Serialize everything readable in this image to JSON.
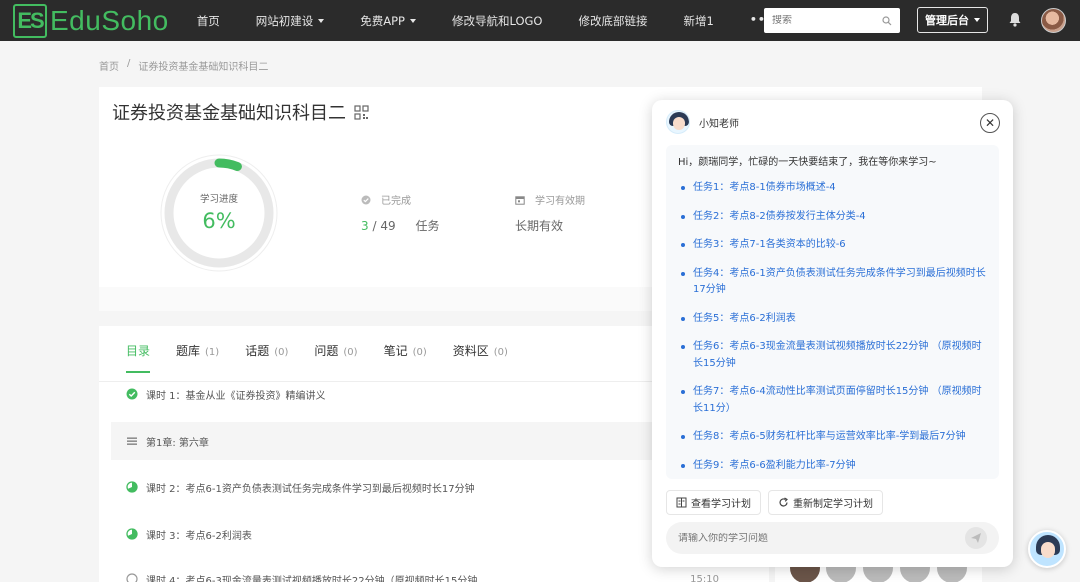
{
  "header": {
    "logo_mark": "ES",
    "logo_text": "EduSoho",
    "nav": [
      {
        "label": "首页",
        "has_caret": false
      },
      {
        "label": "网站初建设",
        "has_caret": true
      },
      {
        "label": "免费APP",
        "has_caret": true
      },
      {
        "label": "修改导航和LOGO",
        "has_caret": false
      },
      {
        "label": "修改底部链接",
        "has_caret": false
      },
      {
        "label": "新增1",
        "has_caret": false
      }
    ],
    "more_label": "•••",
    "search_placeholder": "搜索",
    "admin_label": "管理后台"
  },
  "breadcrumb": {
    "home": "首页",
    "separator": "/",
    "current": "证券投资基金基础知识科目二"
  },
  "course": {
    "title": "证券投资基金基础知识科目二",
    "progress_label": "学习进度",
    "progress_value": "6%",
    "progress_fraction": 0.06,
    "completed_label": "已完成",
    "completed_done": "3",
    "completed_total": "/ 49",
    "completed_unit": "任务",
    "validity_label": "学习有效期",
    "validity_value": "长期有效"
  },
  "tabs": [
    {
      "label": "目录",
      "count": "",
      "active": true
    },
    {
      "label": "题库",
      "count": "(1)",
      "active": false
    },
    {
      "label": "话题",
      "count": "(0)",
      "active": false
    },
    {
      "label": "问题",
      "count": "(0)",
      "active": false
    },
    {
      "label": "笔记",
      "count": "(0)",
      "active": false
    },
    {
      "label": "资料区",
      "count": "(0)",
      "active": false
    }
  ],
  "lessons": [
    {
      "text": "课时 1：基金从业《证券投资》精编讲义",
      "status": "done",
      "time": ""
    },
    {
      "text": "第1章: 第六章",
      "status": "chapter",
      "time": ""
    },
    {
      "text": "课时 2：考点6-1资产负债表测试任务完成条件学习到最后视频时长17分钟",
      "status": "partial",
      "time": ""
    },
    {
      "text": "课时 3：考点6-2利润表",
      "status": "partial",
      "time": ""
    },
    {
      "text": "课时 4：考点6-3现金流量表测试视频播放时长22分钟（原视频时长15分钟",
      "status": "empty",
      "time": "15:10"
    }
  ],
  "chat": {
    "bot_name": "小知老师",
    "greeting": "Hi，颜瑞同学，忙碌的一天快要结束了，我在等你来学习~",
    "tasks": [
      "任务1：考点8-1债券市场概述-4",
      "任务2：考点8-2债券按发行主体分类-4",
      "任务3：考点7-1各类资本的比较-6",
      "任务4：考点6-1资产负债表测试任务完成条件学习到最后视频时长17分钟",
      "任务5：考点6-2利润表",
      "任务6：考点6-3现金流量表测试视频播放时长22分钟 （原视频时长15分钟",
      "任务7：考点6-4流动性比率测试页面停留时长15分钟 （原视频时长11分）",
      "任务8：考点6-5财务杠杆比率与运营效率比率-学到最后7分钟",
      "任务9：考点6-6盈利能力比率-7分钟"
    ],
    "view_plan_label": "查看学习计划",
    "remake_plan_label": "重新制定学习计划",
    "input_placeholder": "请输入你的学习问题"
  },
  "colors": {
    "accent": "#43bc60",
    "link": "#2a6fd6",
    "topbar": "#2b2b2b"
  },
  "icons": [
    "qrcode-icon",
    "check-circle-icon",
    "calendar-icon",
    "search-icon",
    "bell-icon",
    "close-icon",
    "send-icon",
    "list-icon",
    "refresh-icon"
  ]
}
